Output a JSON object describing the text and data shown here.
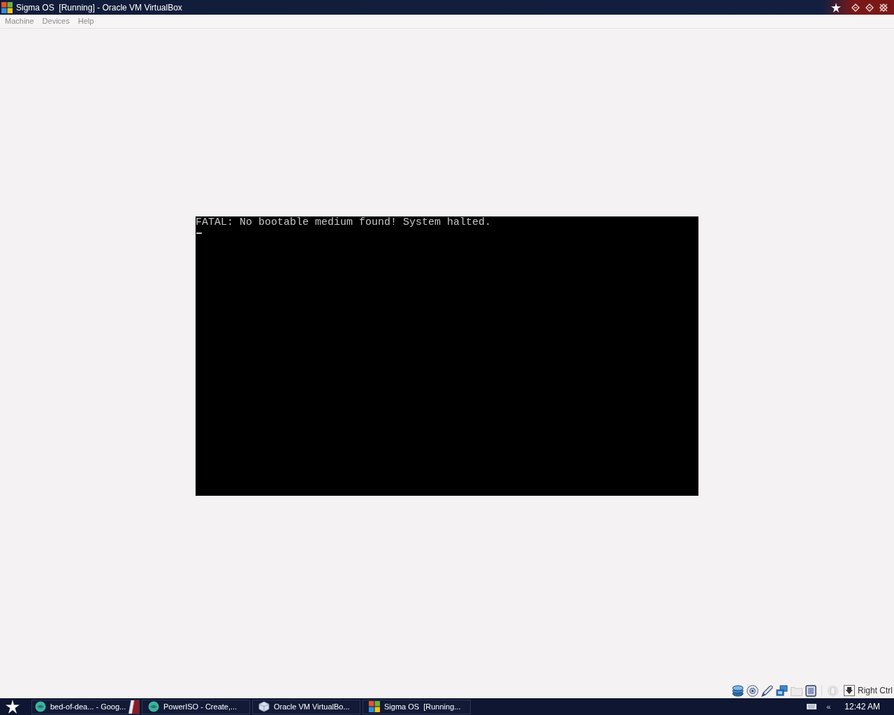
{
  "window": {
    "title": "Sigma OS  [Running] - Oracle VM VirtualBox"
  },
  "menu": [
    {
      "label": "Machine"
    },
    {
      "label": "Devices"
    },
    {
      "label": "Help"
    }
  ],
  "vm_screen": {
    "lines": [
      "FATAL: No bootable medium found! System halted."
    ]
  },
  "status_bar": {
    "indicators": [
      {
        "kind": "hard-disk",
        "disabled": false
      },
      {
        "kind": "optical",
        "disabled": false
      },
      {
        "kind": "usb",
        "disabled": false
      },
      {
        "kind": "network",
        "disabled": false
      },
      {
        "kind": "shared-folders",
        "disabled": true
      },
      {
        "kind": "virtualization",
        "disabled": false
      },
      {
        "kind": "mouse",
        "disabled": true
      }
    ],
    "host_key": "Right Ctrl"
  },
  "taskbar": {
    "tasks": [
      {
        "label": "bed-of-dea... - Goog...",
        "kind": "browser"
      },
      {
        "label": "PowerISO - Create,...",
        "kind": "poweriso"
      },
      {
        "label": "Oracle VM VirtualBo...",
        "kind": "virtualbox"
      },
      {
        "label": "Sigma OS  [Running...",
        "kind": "vm"
      }
    ],
    "tray": {
      "chevron": "«",
      "clock": "12:42 AM"
    }
  }
}
